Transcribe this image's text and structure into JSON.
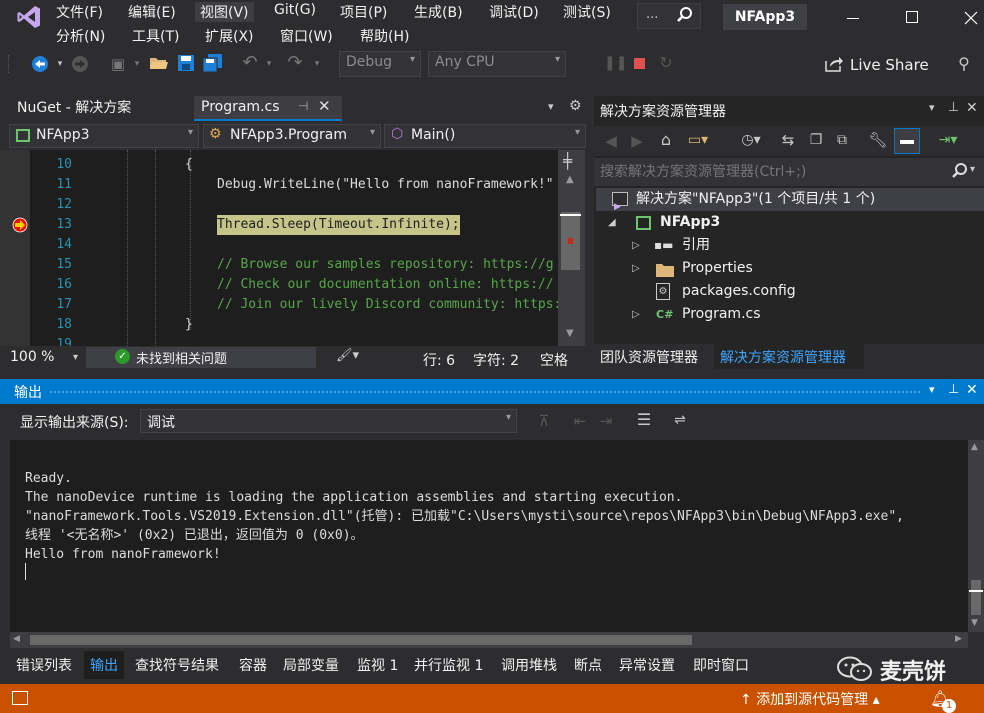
{
  "menu": {
    "row1": [
      "文件(F)",
      "编辑(E)",
      "视图(V)",
      "Git(G)",
      "项目(P)",
      "生成(B)",
      "调试(D)",
      "测试(S)"
    ],
    "row2": [
      "分析(N)",
      "工具(T)",
      "扩展(X)",
      "窗口(W)",
      "帮助(H)"
    ],
    "search_ellipsis": "...",
    "solution_name": "NFApp3"
  },
  "toolbar": {
    "config": "Debug",
    "platform": "Any CPU",
    "live_share": "Live Share"
  },
  "editor": {
    "tabs": [
      {
        "label": "NuGet - 解决方案"
      },
      {
        "label": "Program.cs"
      }
    ],
    "nav": {
      "project": "NFApp3",
      "class": "NFApp3.Program",
      "member": "Main()"
    },
    "lines": [
      {
        "num": "10",
        "indent": "{",
        "code": ""
      },
      {
        "num": "11",
        "indent": "",
        "code": "Debug.WriteLine(\"Hello from nanoFramework!\""
      },
      {
        "num": "12",
        "indent": "",
        "code": ""
      },
      {
        "num": "13",
        "indent": "",
        "code": "Thread.Sleep(Timeout.Infinite);"
      },
      {
        "num": "14",
        "indent": "",
        "code": ""
      },
      {
        "num": "15",
        "indent": "",
        "code": "// Browse our samples repository: https://g"
      },
      {
        "num": "16",
        "indent": "",
        "code": "// Check our documentation online: https://"
      },
      {
        "num": "17",
        "indent": "",
        "code": "// Join our lively Discord community: https:"
      },
      {
        "num": "18",
        "indent": "}",
        "code": ""
      },
      {
        "num": "19",
        "indent": "",
        "code": ""
      }
    ],
    "status": {
      "zoom": "100 %",
      "issues": "未找到相关问题",
      "line": "行: 6",
      "char": "字符: 2",
      "mode": "空格"
    }
  },
  "solution_explorer": {
    "title": "解决方案资源管理器",
    "search_placeholder": "搜索解决方案资源管理器(Ctrl+;)",
    "items": [
      {
        "label": "解决方案\"NFApp3\"(1 个项目/共 1 个)"
      },
      {
        "label": "NFApp3"
      },
      {
        "label": "引用"
      },
      {
        "label": "Properties"
      },
      {
        "label": "packages.config"
      },
      {
        "label": "Program.cs"
      }
    ],
    "bottom_tabs": [
      "团队资源管理器",
      "解决方案资源管理器"
    ]
  },
  "output": {
    "title": "输出",
    "source_label": "显示输出来源(S):",
    "source_value": "调试",
    "lines": [
      "Ready.",
      "The nanoDevice runtime is loading the application assemblies and starting execution.",
      "\"nanoFramework.Tools.VS2019.Extension.dll\"(托管): 已加载\"C:\\Users\\mysti\\source\\repos\\NFApp3\\bin\\Debug\\NFApp3.exe\",",
      "线程 '<无名称>' (0x2) 已退出，返回值为 0 (0x0)。",
      "Hello from nanoFramework!"
    ]
  },
  "bottom_tabs": [
    "错误列表",
    "输出",
    "查找符号结果",
    "容器",
    "局部变量",
    "监视 1",
    "并行监视 1",
    "调用堆栈",
    "断点",
    "异常设置",
    "即时窗口"
  ],
  "watermark": "麦壳饼",
  "statusbar": {
    "add_source": "添加到源代码管理",
    "notif_count": "1"
  }
}
